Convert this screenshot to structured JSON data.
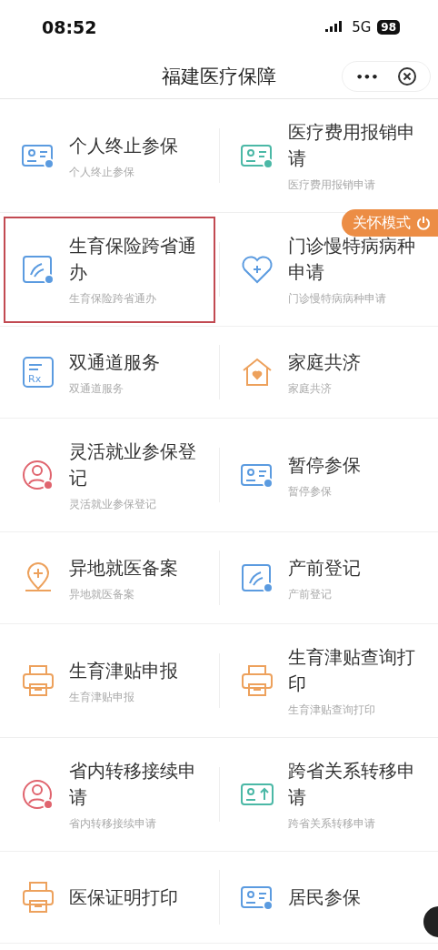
{
  "status_bar": {
    "time": "08:52",
    "network": "5G",
    "battery": "98"
  },
  "nav": {
    "title": "福建医疗保障",
    "more": "•••"
  },
  "care_mode": {
    "label": "关怀模式"
  },
  "services": [
    {
      "title": "个人终止参保",
      "subtitle": "个人终止参保",
      "kind": "card",
      "color": "#5b9be0",
      "highlighted": false
    },
    {
      "title": "医疗费用报销申请",
      "subtitle": "医疗费用报销申请",
      "kind": "card",
      "color": "#4bb8a6",
      "highlighted": false
    },
    {
      "title": "生育保险跨省通办",
      "subtitle": "生育保险跨省通办",
      "kind": "hand",
      "color": "#5b9be0",
      "highlighted": true
    },
    {
      "title": "门诊慢特病病种申请",
      "subtitle": "门诊慢特病病种申请",
      "kind": "heart",
      "color": "#5b9be0",
      "highlighted": false
    },
    {
      "title": "双通道服务",
      "subtitle": "双通道服务",
      "kind": "rx",
      "icon_label": "Rx",
      "color": "#5b9be0",
      "highlighted": false
    },
    {
      "title": "家庭共济",
      "subtitle": "家庭共济",
      "kind": "house",
      "color": "#eda15c",
      "highlighted": false
    },
    {
      "title": "灵活就业参保登记",
      "subtitle": "灵活就业参保登记",
      "kind": "person",
      "color": "#e0646e",
      "highlighted": false
    },
    {
      "title": "暂停参保",
      "subtitle": "暂停参保",
      "kind": "card",
      "color": "#5b9be0",
      "highlighted": false
    },
    {
      "title": "异地就医备案",
      "subtitle": "异地就医备案",
      "kind": "pin",
      "color": "#eda15c",
      "highlighted": false
    },
    {
      "title": "产前登记",
      "subtitle": "产前登记",
      "kind": "hand",
      "color": "#5b9be0",
      "highlighted": false
    },
    {
      "title": "生育津贴申报",
      "subtitle": "生育津贴申报",
      "kind": "printer",
      "color": "#eda15c",
      "highlighted": false
    },
    {
      "title": "生育津贴查询打印",
      "subtitle": "生育津贴查询打印",
      "kind": "printer",
      "color": "#eda15c",
      "highlighted": false
    },
    {
      "title": "省内转移接续申请",
      "subtitle": "省内转移接续申请",
      "kind": "person",
      "color": "#e0646e",
      "highlighted": false
    },
    {
      "title": "跨省关系转移申请",
      "subtitle": "跨省关系转移申请",
      "kind": "upload",
      "color": "#4bb8a6",
      "highlighted": false
    },
    {
      "title": "医保证明打印",
      "kind": "printer",
      "color": "#eda15c",
      "highlighted": false
    },
    {
      "title": "居民参保",
      "kind": "card",
      "color": "#5b9be0",
      "highlighted": false
    }
  ]
}
